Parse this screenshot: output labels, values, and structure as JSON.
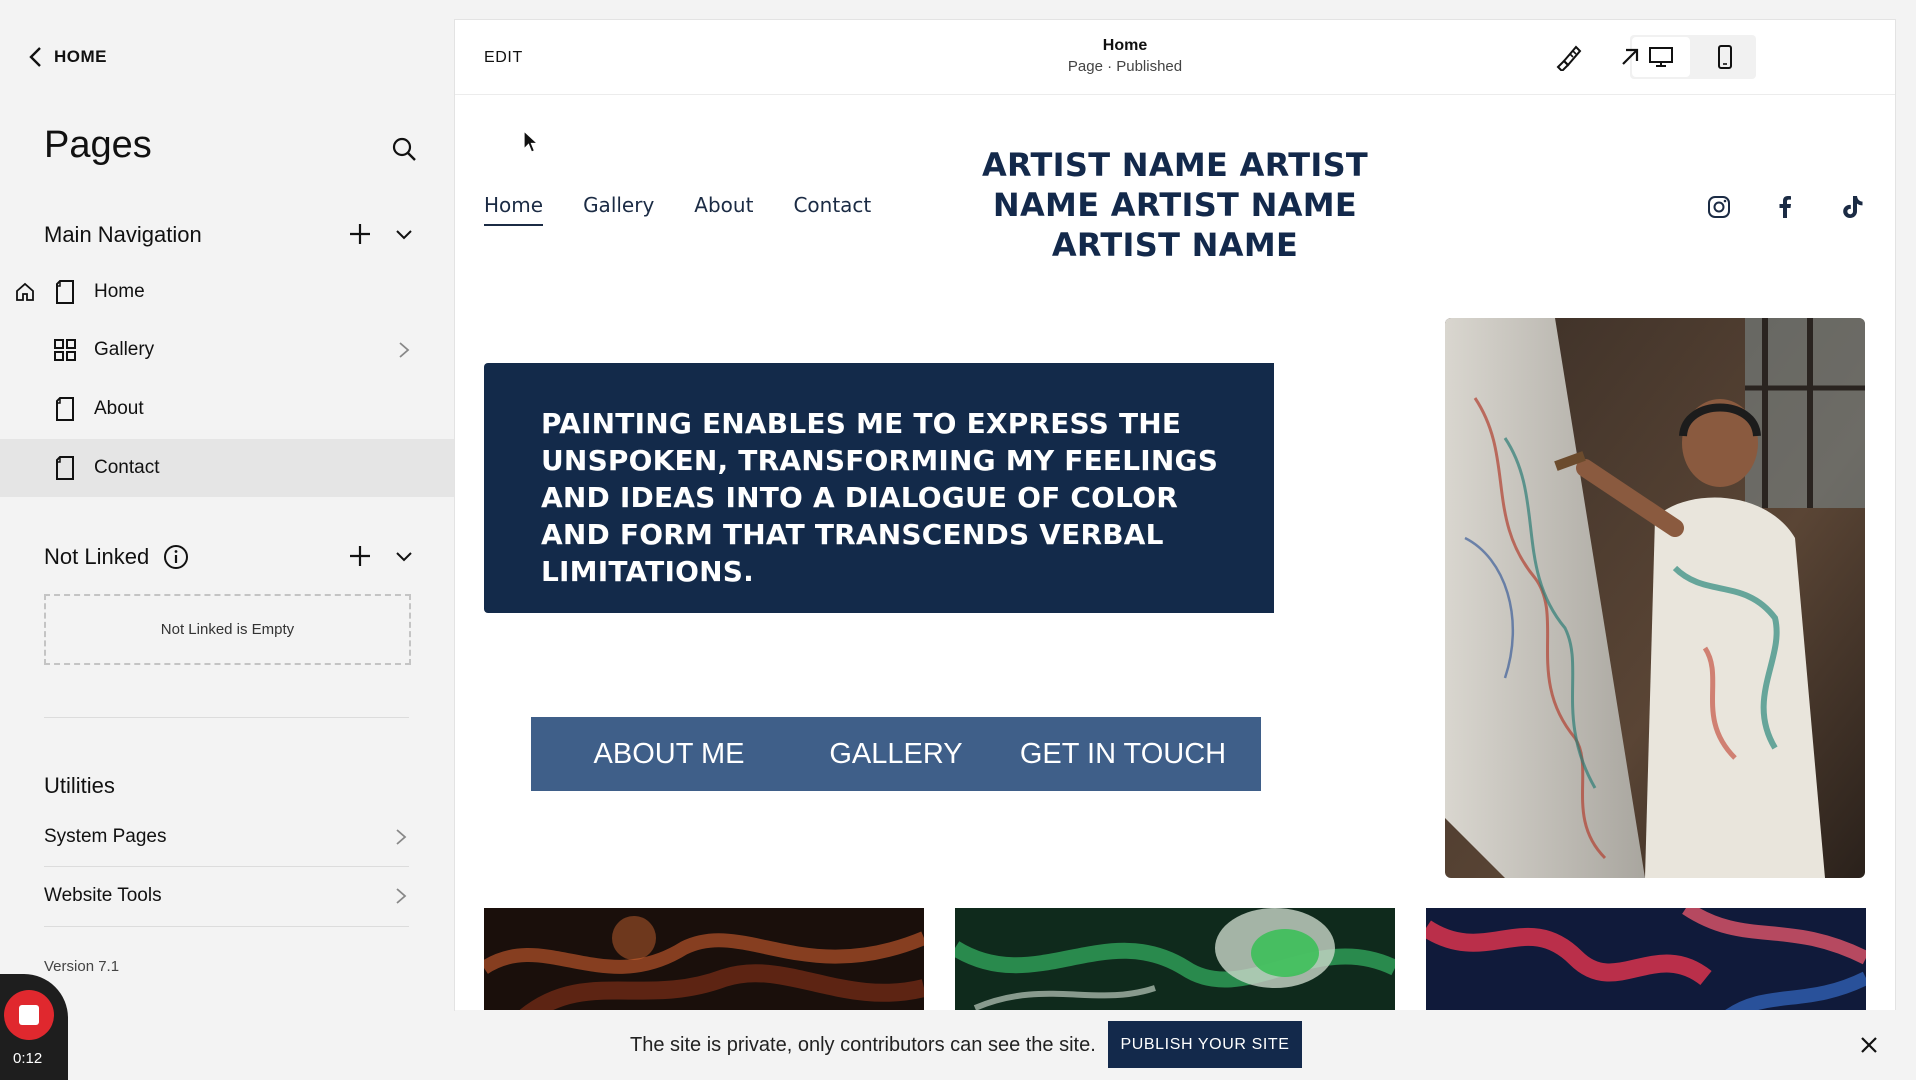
{
  "sidebar": {
    "back_label": "HOME",
    "title": "Pages",
    "main_nav": {
      "heading": "Main Navigation",
      "items": [
        {
          "label": "Home"
        },
        {
          "label": "Gallery"
        },
        {
          "label": "About"
        },
        {
          "label": "Contact"
        }
      ]
    },
    "not_linked": {
      "heading": "Not Linked",
      "empty_text": "Not Linked is Empty"
    },
    "utilities": {
      "heading": "Utilities",
      "items": [
        {
          "label": "System Pages"
        },
        {
          "label": "Website Tools"
        }
      ]
    },
    "version": "Version 7.1"
  },
  "recorder": {
    "time": "0:12"
  },
  "editor": {
    "edit_label": "EDIT",
    "page_title": "Home",
    "page_status": "Page · Published",
    "site": {
      "nav": [
        "Home",
        "Gallery",
        "About",
        "Contact"
      ],
      "title": "ARTIST NAME ARTIST NAME ARTIST NAME ARTIST NAME",
      "hero_quote": "PAINTING ENABLES ME TO EXPRESS THE UNSPOKEN, TRANSFORMING MY FEELINGS AND IDEAS INTO A DIALOGUE OF COLOR AND FORM THAT TRANSCENDS VERBAL LIMITATIONS.",
      "buttons": [
        "ABOUT ME",
        "GALLERY",
        "GET IN TOUCH"
      ]
    }
  },
  "banner": {
    "text": "The site is private, only contributors can see the site.",
    "publish_label": "PUBLISH YOUR SITE"
  },
  "colors": {
    "navy": "#132a4a",
    "cta_blue": "#3f5f89",
    "record_red": "#e0282e"
  }
}
